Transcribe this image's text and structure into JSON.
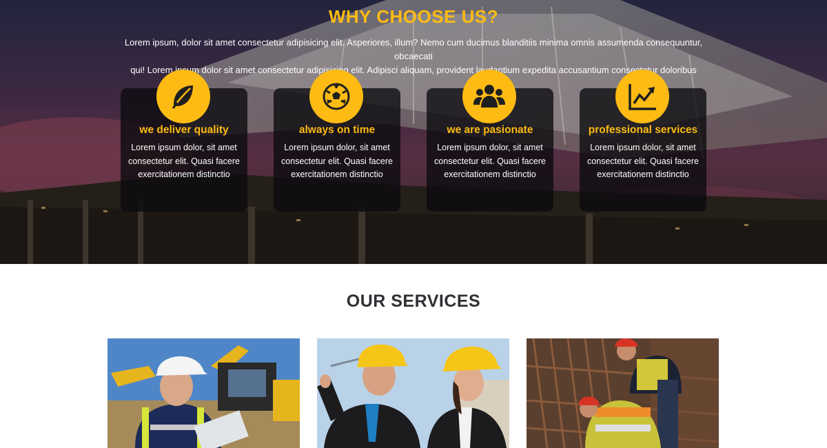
{
  "colors": {
    "accent": "#fdbb13",
    "text_light": "#ffffff",
    "heading_dark": "#2f2f34",
    "card_bg": "rgba(10,10,14,0.78)"
  },
  "why": {
    "title": "WHY CHOOSE US?",
    "description_line1": "Lorem ipsum, dolor sit amet consectetur adipisicing elit. Asperiores, illum? Nemo cum ducimus blanditiis minima omnis assumenda consequuntur, obcaecati",
    "description_line2": "qui! Lorem ipsum dolor sit amet consectetur adipisicing elit. Adipisci aliquam, provident laudantium expedita accusantium consectetur doloribus",
    "features": [
      {
        "icon": "leaf-icon",
        "title": "we deliver quality",
        "text": "Lorem ipsum dolor, sit amet consectetur elit. Quasi facere exercitationem distinctio"
      },
      {
        "icon": "soccer-ball-icon",
        "title": "always on time",
        "text": "Lorem ipsum dolor, sit amet consectetur elit. Quasi facere exercitationem distinctio"
      },
      {
        "icon": "users-icon",
        "title": "we are pasionate",
        "text": "Lorem ipsum dolor, sit amet consectetur elit. Quasi facere exercitationem distinctio"
      },
      {
        "icon": "chart-line-icon",
        "title": "professional services",
        "text": "Lorem ipsum dolor, sit amet consectetur elit. Quasi facere exercitationem distinctio"
      }
    ]
  },
  "services": {
    "title": "OUR SERVICES",
    "images": [
      {
        "subject": "engineer-excavator-photo"
      },
      {
        "subject": "engineers-hardhats-photo"
      },
      {
        "subject": "workers-rebar-photo"
      }
    ]
  }
}
